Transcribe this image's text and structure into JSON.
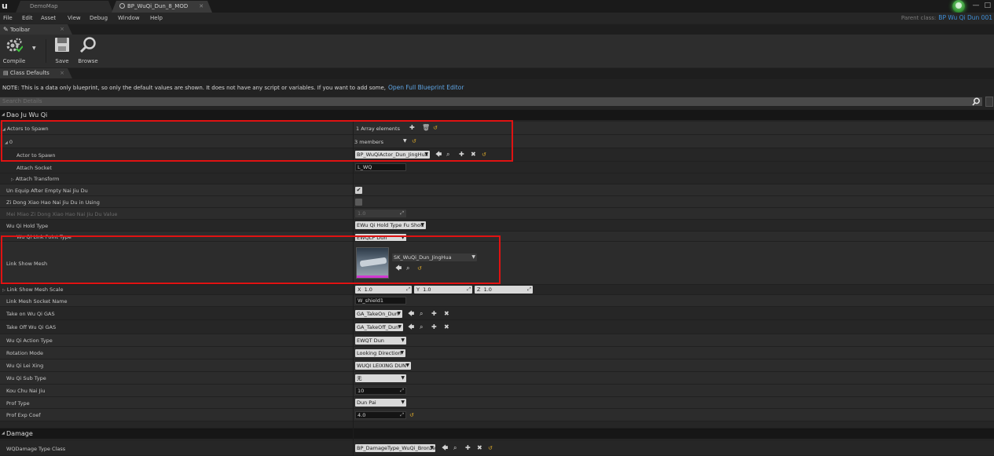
{
  "window": {
    "tabs": [
      {
        "label": "DemoMap"
      },
      {
        "label": "BP_WuQi_Dun_8_MOD"
      }
    ]
  },
  "menu": {
    "items": [
      "File",
      "Edit",
      "Asset",
      "View",
      "Debug",
      "Window",
      "Help"
    ],
    "parent_class_label": "Parent class:",
    "parent_class_value": "BP Wu Qi Dun 001"
  },
  "toolbar": {
    "tab_label": "Toolbar",
    "compile_label": "Compile",
    "save_label": "Save",
    "browse_label": "Browse"
  },
  "class_defaults": {
    "tab_label": "Class Defaults",
    "note": "NOTE: This is a data only blueprint, so only the default values are shown.  It does not have any script or variables.  If you want to add some,",
    "note_link": "Open Full Blueprint Editor",
    "search_placeholder": "Search Details"
  },
  "sections": {
    "dao_ju": "Dao Ju Wu Qi",
    "damage": "Damage"
  },
  "props": {
    "actors_to_spawn": {
      "label": "Actors to Spawn",
      "value": "1 Array elements"
    },
    "elem0": {
      "label": "0",
      "value": "3 members"
    },
    "actor_to_spawn": {
      "label": "Actor to Spawn",
      "value": "BP_WuQiActor_Dun_JingHua"
    },
    "attach_socket": {
      "label": "Attach Socket",
      "value": "L_WQ"
    },
    "attach_transform": {
      "label": "Attach Transform"
    },
    "unequip": {
      "label": "Un Equip After Empty Nai Jiu Du",
      "checked": true
    },
    "zi_dong": {
      "label": "Zi Dong Xiao Hao Nai Jiu Du in Using",
      "checked": false
    },
    "mei_miao": {
      "label": "Mei Miao Zi Dong Xiao Hao Nai Jiu Du Value",
      "value": "1.0"
    },
    "hold_type": {
      "label": "Wu Qi Hold Type",
      "value": "EWu Qi Hold Type Fu Shou"
    },
    "link_point": {
      "label": "Wu Qi Link Point Type",
      "value": "EWQLP Dun"
    },
    "link_show_mesh": {
      "label": "Link Show Mesh",
      "value": "SK_WuQi_Dun_JingHua"
    },
    "mesh_scale": {
      "label": "Link Show Mesh Scale",
      "x_label": "X",
      "x": "1.0",
      "y_label": "Y",
      "y": "1.0",
      "z_label": "Z",
      "z": "1.0"
    },
    "socket_name": {
      "label": "Link Mesh Socket Name",
      "value": "W_shield1"
    },
    "take_on": {
      "label": "Take on Wu Qi GAS",
      "value": "GA_TakeOn_Dun"
    },
    "take_off": {
      "label": "Take Off Wu Qi GAS",
      "value": "GA_TakeOff_Dun"
    },
    "action_type": {
      "label": "Wu Qi Action Type",
      "value": "EWQT Dun"
    },
    "rotation_mode": {
      "label": "Rotation Mode",
      "value": "Looking Direction"
    },
    "lei_xing": {
      "label": "Wu Qi Lei Xing",
      "value": "WUQI LEIXING DUN"
    },
    "sub_type": {
      "label": "Wu Qi Sub Type",
      "value": "无"
    },
    "kou_chu": {
      "label": "Kou Chu Nai Jiu",
      "value": "10"
    },
    "prof_type": {
      "label": "Prof Type",
      "value": "Dun Pai"
    },
    "prof_exp": {
      "label": "Prof Exp Coef",
      "value": "4.0"
    },
    "damage_type": {
      "label": "WQDamage Type Class",
      "value": "BP_DamageType_WuQi_Bronze"
    }
  },
  "colors": {
    "highlight": "#e01212",
    "link": "#5fa6e6",
    "parent_class": "#3f8fd8",
    "reset": "#d8a62a"
  }
}
